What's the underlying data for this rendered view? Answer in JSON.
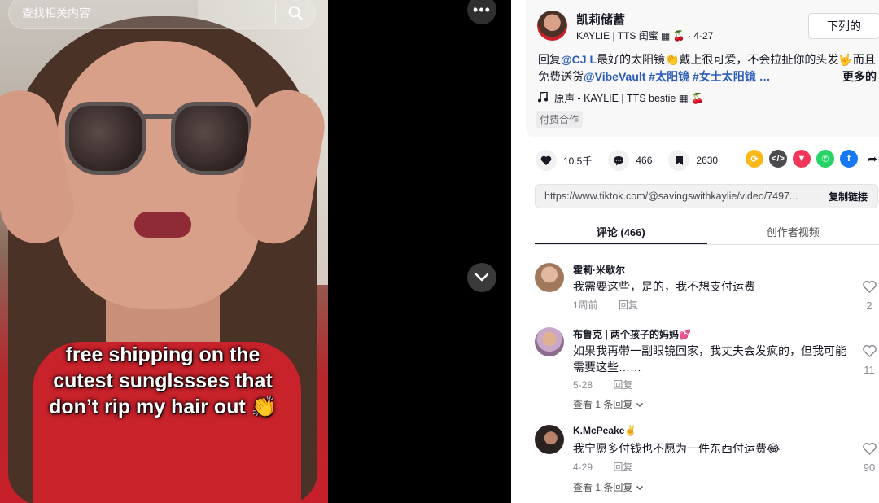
{
  "video": {
    "search_placeholder": "查找相关内容",
    "caption_line1": "free shipping on the",
    "caption_line2": "cutest sunglssses that",
    "caption_line3": "don’t rip my hair out 👏"
  },
  "controls": {
    "more_icon": "•••",
    "down_icon": "chevron-down"
  },
  "post": {
    "author_name": "凯莉储蓄",
    "author_sub": "KAYLIE | TTS 闺蜜 ▦ 🍒 · 4-27",
    "follow_label": "下列的",
    "desc_reply": "回复",
    "desc_mention1": "@CJ L",
    "desc_text1": "最好的太阳镜👏戴上很可爱，不会拉扯你的头发🤟而且免费送货",
    "desc_mention2": "@VibeVault",
    "desc_tag1": " #太阳镜",
    "desc_tag2": " #女士太阳镜 …",
    "desc_more": "更多的",
    "music": "原声 - KAYLIE | TTS bestie ▦ 🍒",
    "tag": "付费合作"
  },
  "actions": {
    "likes": "10.5千",
    "comments": "466",
    "saves": "2630"
  },
  "share": {
    "url": "https://www.tiktok.com/@savingswithkaylie/video/7497...",
    "copy_label": "复制链接"
  },
  "tabs": {
    "comments": "评论 (466)",
    "creator_videos": "创作者视频"
  },
  "comments": [
    {
      "name": "霍莉·米歇尔",
      "text": "我需要这些，是的，我不想支付运费",
      "time": "1周前",
      "reply": "回复",
      "likes": "2",
      "replies": ""
    },
    {
      "name": "布鲁克 | 两个孩子的妈妈💕",
      "text": "如果我再带一副眼镜回家，我丈夫会发疯的，但我可能需要这些……",
      "time": "5-28",
      "reply": "回复",
      "likes": "11",
      "replies": "查看 1 条回复"
    },
    {
      "name": "K.McPeake✌️",
      "text": "我宁愿多付钱也不愿为一件东西付运费😂",
      "time": "4-29",
      "reply": "回复",
      "likes": "90",
      "replies": "查看 1 条回复"
    }
  ],
  "colors": {
    "link": "#2b5db9",
    "text": "#161823",
    "meta": "#8a8b91"
  }
}
